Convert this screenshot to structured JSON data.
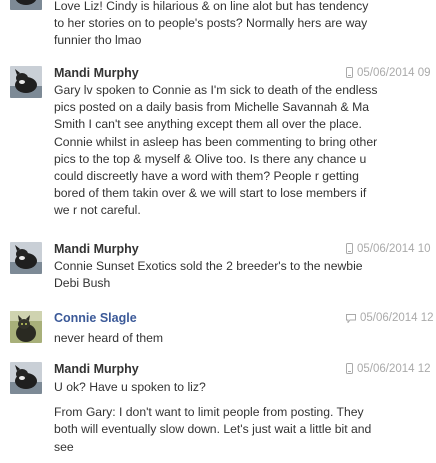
{
  "colors": {
    "link": "#3b5998",
    "text": "#333333",
    "timestamp": "#aaaaaa"
  },
  "messages": [
    {
      "id": "m0",
      "avatar_icon": "dog-avatar-icon",
      "lines": [
        "Love Liz!  Cindy is hilarious & on line alot but has tendency",
        "to her stories on to people's posts? Normally hers are way",
        "funnier tho lmao"
      ]
    },
    {
      "id": "m1",
      "sender": "Mandi Murphy",
      "device_icon": "phone-icon",
      "timestamp": "05/06/2014 09",
      "avatar_icon": "dog-avatar-icon",
      "lines": [
        "Gary lv spoken to Connie as I'm sick to death of the endless",
        "pics posted on a daily basis from Michelle Savannah & Ma",
        "Smith I can't see anything except them all over the place.",
        "Connie whilst in asleep has been commenting to bring other",
        "pics to the top  & myself & Olive too. Is there any chance u",
        "could discreetly have a word with them? People r getting",
        "bored of them takin over & we will start to lose members if",
        "we r not careful."
      ]
    },
    {
      "id": "m2",
      "sender": "Mandi Murphy",
      "device_icon": "phone-icon",
      "timestamp": "05/06/2014 10",
      "avatar_icon": "dog-avatar-icon",
      "lines": [
        "Connie Sunset Exotics sold the 2 breeder's to the newbie",
        "Debi Bush"
      ]
    },
    {
      "id": "m3",
      "sender": "Connie Slagle",
      "device_icon": "chat-bubble-icon",
      "timestamp": "05/06/2014 12",
      "avatar_icon": "cat-avatar-icon",
      "lines": [
        "never heard of them"
      ]
    },
    {
      "id": "m4",
      "sender": "Mandi Murphy",
      "device_icon": "phone-icon",
      "timestamp": "05/06/2014 12",
      "avatar_icon": "dog-avatar-icon",
      "lines": [
        "U ok? Have u spoken to liz?"
      ],
      "lines2": [
        "From Gary: I don't want to limit people from posting. They",
        "both will eventually slow down. Let's just wait a little bit and",
        "see"
      ]
    }
  ]
}
